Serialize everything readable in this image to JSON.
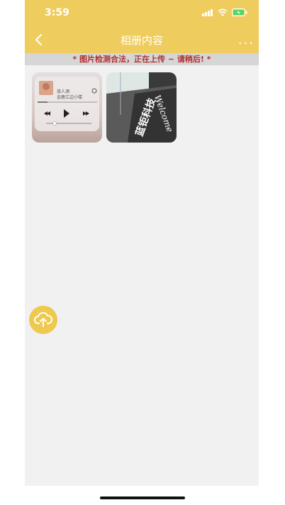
{
  "status_bar": {
    "time": "3:59",
    "icons": [
      "signal-icon",
      "wifi-icon",
      "battery-charging-icon"
    ]
  },
  "nav": {
    "title": "相册内容",
    "back_icon": "chevron-left-icon",
    "more_label": "..."
  },
  "notice": {
    "text": "* 图片检测合法，正在上传 ~ 请稍后! *"
  },
  "photos": [
    {
      "name": "music-player-screenshot",
      "song_title": "旅人酒",
      "artist": "金鹿江边小楼"
    },
    {
      "name": "welcome-carpet-photo",
      "carpet_text": "蓝钜科技",
      "welcome_text": "Welcome"
    }
  ],
  "upload": {
    "icon": "cloud-upload-icon"
  },
  "colors": {
    "header": "#eecd5e",
    "notice_text": "#b03030",
    "upload_button": "#eec94f",
    "background": "#f1f1f1"
  }
}
